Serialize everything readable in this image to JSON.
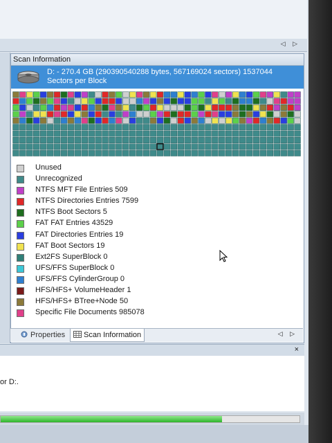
{
  "scan_pane": {
    "title": "Scan Information",
    "close": "×",
    "drive_info": "D: - 270.4 GB (290390540288 bytes, 567169024 sectors) 1537044 Sectors per Block",
    "icon": "hard-drive-icon"
  },
  "top_nav_arrows": "◁ ▷",
  "legend": [
    {
      "label": "Unused",
      "color": "#cfcfcf"
    },
    {
      "label": "Unrecognized",
      "color": "#3f8a8a"
    },
    {
      "label": "NTFS MFT File Entries 509",
      "color": "#c040c8"
    },
    {
      "label": "NTFS Directories Entries 7599",
      "color": "#e02828"
    },
    {
      "label": "NTFS Boot Sectors 5",
      "color": "#1f6e1f"
    },
    {
      "label": "FAT FAT Entries 43529",
      "color": "#5cd04a"
    },
    {
      "label": "FAT Directories Entries 19",
      "color": "#2a3ee0"
    },
    {
      "label": "FAT Boot Sectors 19",
      "color": "#f0e250"
    },
    {
      "label": "Ext2FS SuperBlock 0",
      "color": "#2f7f78"
    },
    {
      "label": "UFS/FFS SuperBlock 0",
      "color": "#3cc8d8"
    },
    {
      "label": "UFS/FFS CylinderGroup 0",
      "color": "#2f7fd0"
    },
    {
      "label": "HFS/HFS+ VolumeHeader 1",
      "color": "#7a1a1a"
    },
    {
      "label": "HFS/HFS+ BTree+Node 50",
      "color": "#8c7a3a"
    },
    {
      "label": "Specific File Documents 985078",
      "color": "#e0408a"
    }
  ],
  "tabs": {
    "properties": "Properties",
    "scan_information": "Scan Information",
    "arrows": "◁ ▷"
  },
  "lower_panel": {
    "close": "×",
    "log_text": "or D:."
  },
  "progress": {
    "fraction": 0.74
  },
  "block_map": {
    "columns": 42,
    "rows": 10,
    "filled_rows": 5,
    "palette": [
      "#e02828",
      "#f0e250",
      "#5cd04a",
      "#c040c8",
      "#2a3ee0",
      "#8c7a3a",
      "#e0408a",
      "#cfcfcf",
      "#3f8a8a",
      "#1f6e1f",
      "#2f7fd0"
    ],
    "selected_cell": {
      "row": 8,
      "col": 21
    }
  }
}
